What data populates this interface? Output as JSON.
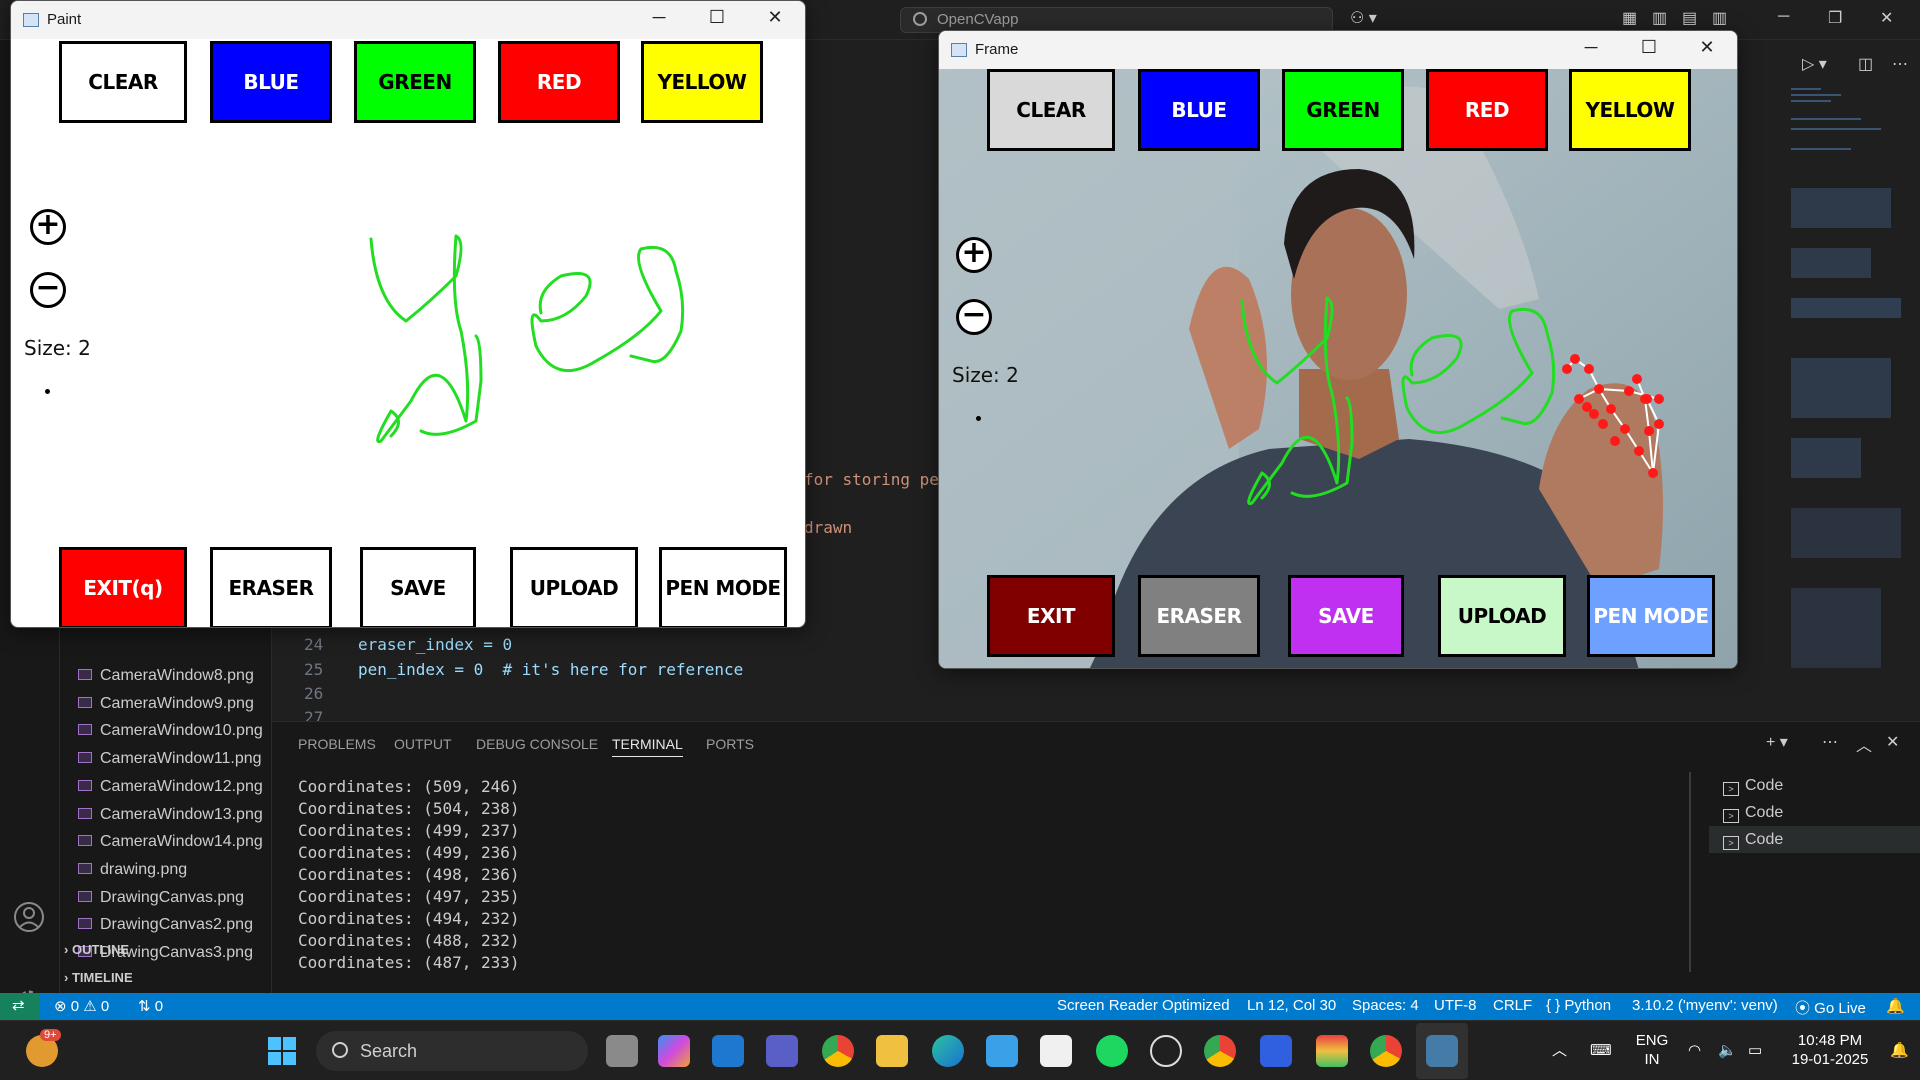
{
  "vscode": {
    "search_text": "OpenCVapp",
    "files": [
      "CameraWindow8.png",
      "CameraWindow9.png",
      "CameraWindow10.png",
      "CameraWindow11.png",
      "CameraWindow12.png",
      "CameraWindow13.png",
      "CameraWindow14.png",
      "drawing.png",
      "DrawingCanvas.png",
      "DrawingCanvas2.png",
      "DrawingCanvas3.png"
    ],
    "sections": [
      "OUTLINE",
      "TIMELINE"
    ],
    "code": {
      "ln24": "24",
      "line24": "eraser_index = 0",
      "ln25": "25",
      "line25": "pen_index = 0  # it's here for reference",
      "ln26": "26",
      "ln27": "27",
      "frag1": "for storing pe",
      "frag2": "drawn"
    },
    "panel_tabs": [
      "PROBLEMS",
      "OUTPUT",
      "DEBUG CONSOLE",
      "TERMINAL",
      "PORTS"
    ],
    "active_tab": "TERMINAL",
    "terminal_lines": [
      "Coordinates: (509, 246)",
      "Coordinates: (504, 238)",
      "Coordinates: (499, 237)",
      "Coordinates: (499, 236)",
      "Coordinates: (498, 236)",
      "Coordinates: (497, 235)",
      "Coordinates: (494, 232)",
      "Coordinates: (488, 232)",
      "Coordinates: (487, 233)"
    ],
    "terminal_instances": [
      "Code",
      "Code",
      "Code"
    ],
    "status": {
      "errors": "0",
      "warnings": "0",
      "ports": "0",
      "screen_reader": "Screen Reader Optimized",
      "position": "Ln 12, Col 30",
      "spaces": "Spaces: 4",
      "encoding": "UTF-8",
      "eol": "CRLF",
      "language": "Python",
      "interpreter": "3.10.2 ('myenv': venv)",
      "golive": "Go Live"
    }
  },
  "paint_window": {
    "title": "Paint",
    "top_buttons": [
      {
        "label": "CLEAR",
        "bg": "#ffffff",
        "fg": "#000000"
      },
      {
        "label": "BLUE",
        "bg": "#0000ff",
        "fg": "#ffffff"
      },
      {
        "label": "GREEN",
        "bg": "#00ff00",
        "fg": "#000000"
      },
      {
        "label": "RED",
        "bg": "#ff0000",
        "fg": "#ffffff"
      },
      {
        "label": "YELLOW",
        "bg": "#ffff00",
        "fg": "#000000"
      }
    ],
    "bottom_buttons": [
      {
        "label": "EXIT(q)",
        "bg": "#ff0000",
        "fg": "#ffffff"
      },
      {
        "label": "ERASER",
        "bg": "#ffffff",
        "fg": "#000000"
      },
      {
        "label": "SAVE",
        "bg": "#ffffff",
        "fg": "#000000"
      },
      {
        "label": "UPLOAD",
        "bg": "#ffffff",
        "fg": "#000000"
      },
      {
        "label": "PEN MODE",
        "bg": "#ffffff",
        "fg": "#000000"
      }
    ],
    "plus": "+",
    "minus": "−",
    "size_label": "Size: 2",
    "ink_color": "#22dd22"
  },
  "frame_window": {
    "title": "Frame",
    "top_buttons": [
      {
        "label": "CLEAR",
        "bg": "#d9d9d9",
        "fg": "#000000"
      },
      {
        "label": "BLUE",
        "bg": "#0000ff",
        "fg": "#ffffff"
      },
      {
        "label": "GREEN",
        "bg": "#00ff00",
        "fg": "#000000"
      },
      {
        "label": "RED",
        "bg": "#ff0000",
        "fg": "#ffffff"
      },
      {
        "label": "YELLOW",
        "bg": "#ffff00",
        "fg": "#000000"
      }
    ],
    "bottom_buttons": [
      {
        "label": "EXIT",
        "bg": "#800000",
        "fg": "#ffffff"
      },
      {
        "label": "ERASER",
        "bg": "#808080",
        "fg": "#ffffff"
      },
      {
        "label": "SAVE",
        "bg": "#c030f0",
        "fg": "#ffffff"
      },
      {
        "label": "UPLOAD",
        "bg": "#c8f8c8",
        "fg": "#000000"
      },
      {
        "label": "PEN MODE",
        "bg": "#6ea0ff",
        "fg": "#ffffff"
      }
    ],
    "plus": "+",
    "minus": "−",
    "size_label": "Size: 2"
  },
  "taskbar": {
    "search": "Search",
    "notif_badge": "9+",
    "lang_top": "ENG",
    "lang_bottom": "IN",
    "time": "10:48 PM",
    "date": "19-01-2025"
  }
}
